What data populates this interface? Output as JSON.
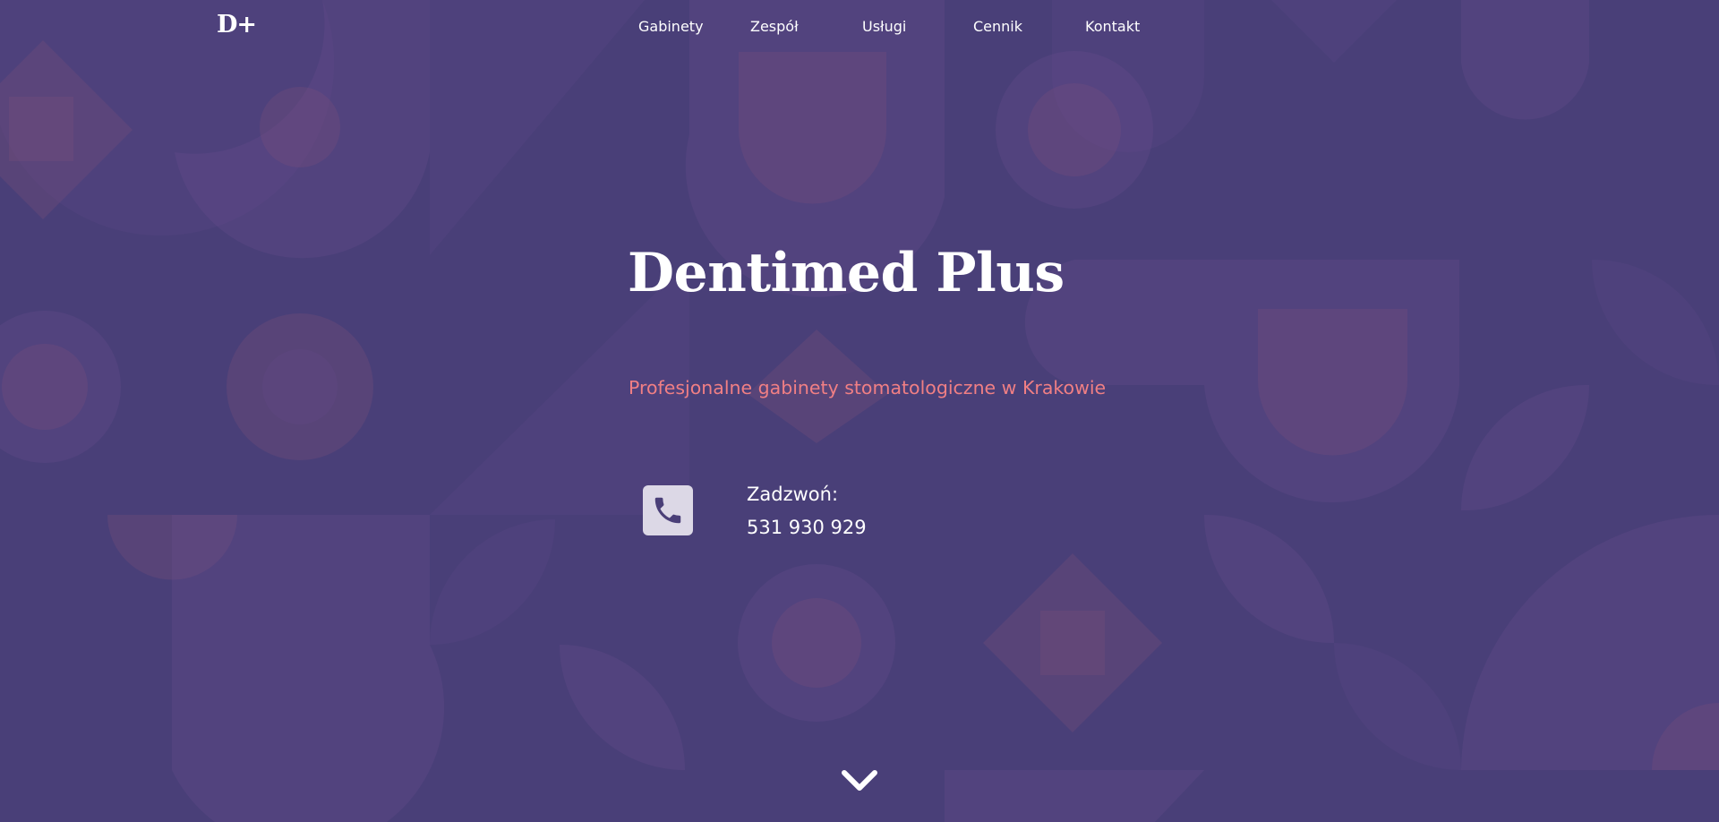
{
  "header": {
    "logo_text": "D+",
    "nav": [
      {
        "label": "Gabinety"
      },
      {
        "label": "Zespół"
      },
      {
        "label": "Usługi"
      },
      {
        "label": "Cennik"
      },
      {
        "label": "Kontakt"
      }
    ]
  },
  "hero": {
    "title": "Dentimed Plus",
    "subtitle": "Profesjonalne gabinety stomatologiczne w Krakowie",
    "call_label": "Zadzwoń:",
    "phone_number": "531 930 929",
    "phone_icon": "phone-icon",
    "scroll_icon": "chevron-down-icon"
  },
  "colors": {
    "background": "#493f78",
    "accent": "#f07f84",
    "text": "#ffffff",
    "icon_box": "#dcd8e6"
  }
}
